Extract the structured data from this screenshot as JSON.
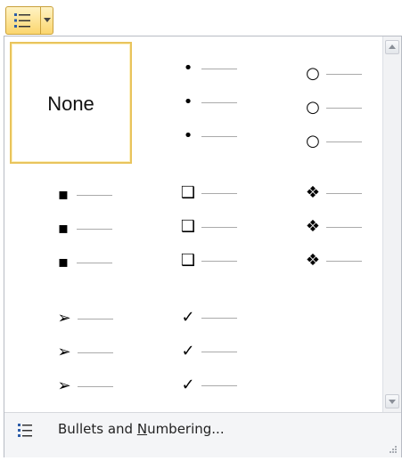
{
  "toolbar": {
    "bullets_button": {
      "icon": "bullet-list-icon",
      "accent": "#fbd66e"
    },
    "dropdown_arrow": {
      "icon": "chevron-down-icon"
    }
  },
  "gallery": {
    "none_label": "None",
    "styles": [
      {
        "name": "none"
      },
      {
        "name": "filled-dot",
        "glyph": "•"
      },
      {
        "name": "hollow-circle",
        "glyph": "○"
      },
      {
        "name": "filled-square",
        "glyph": "▪"
      },
      {
        "name": "hollow-square",
        "glyph": "❑"
      },
      {
        "name": "four-diamond",
        "glyph": "❖"
      },
      {
        "name": "arrowhead",
        "glyph": "➢"
      },
      {
        "name": "checkmark",
        "glyph": "✓"
      }
    ],
    "selected": "none"
  },
  "footer": {
    "item_prefix": "Bullets and ",
    "item_mnemonic": "N",
    "item_suffix": "umbering..."
  }
}
